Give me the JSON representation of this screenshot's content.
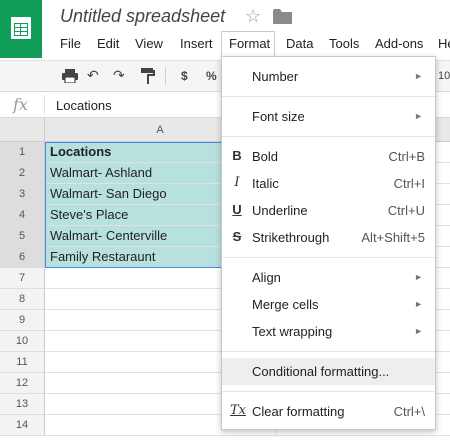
{
  "app": {
    "title": "Untitled spreadsheet"
  },
  "menubar": [
    "File",
    "Edit",
    "View",
    "Insert",
    "Format",
    "Data",
    "Tools",
    "Add-ons",
    "He"
  ],
  "toolbar": {
    "currency": "$",
    "percent": "%",
    "font_size": "10"
  },
  "formula_bar": {
    "fx": "fx",
    "value": "Locations"
  },
  "grid": {
    "column_a": "A",
    "rows": [
      {
        "num": "1",
        "value": "Locations",
        "bold": true
      },
      {
        "num": "2",
        "value": "Walmart- Ashland"
      },
      {
        "num": "3",
        "value": "Walmart- San Diego"
      },
      {
        "num": "4",
        "value": "Steve's Place"
      },
      {
        "num": "5",
        "value": "Walmart- Centerville"
      },
      {
        "num": "6",
        "value": "Family Restaraunt"
      },
      {
        "num": "7",
        "value": ""
      },
      {
        "num": "8",
        "value": ""
      },
      {
        "num": "9",
        "value": ""
      },
      {
        "num": "10",
        "value": ""
      },
      {
        "num": "11",
        "value": ""
      },
      {
        "num": "12",
        "value": ""
      },
      {
        "num": "13",
        "value": ""
      },
      {
        "num": "14",
        "value": ""
      }
    ]
  },
  "format_menu": {
    "number": "Number",
    "font_size": "Font size",
    "bold": {
      "label": "Bold",
      "shortcut": "Ctrl+B",
      "icon": "B"
    },
    "italic": {
      "label": "Italic",
      "shortcut": "Ctrl+I",
      "icon": "I"
    },
    "underline": {
      "label": "Underline",
      "shortcut": "Ctrl+U",
      "icon": "U"
    },
    "strikethrough": {
      "label": "Strikethrough",
      "shortcut": "Alt+Shift+5",
      "icon": "S"
    },
    "align": "Align",
    "merge_cells": "Merge cells",
    "text_wrapping": "Text wrapping",
    "conditional_formatting": "Conditional formatting...",
    "clear_formatting": {
      "label": "Clear formatting",
      "shortcut": "Ctrl+\\",
      "icon": "Tx"
    }
  },
  "colors": {
    "logo": "#0f9d58",
    "selection_fill": "#b7e1dd",
    "selection_border": "#4a86e8"
  }
}
